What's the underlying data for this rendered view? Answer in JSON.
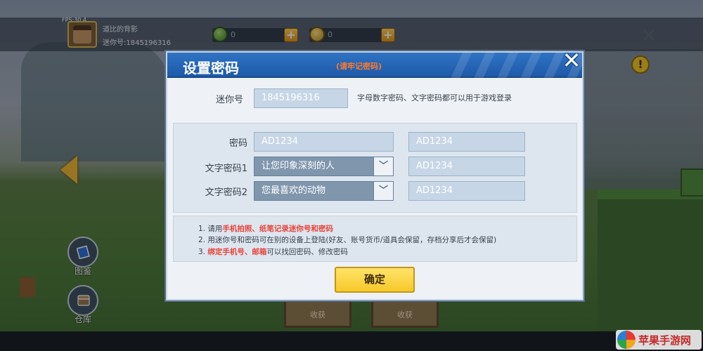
{
  "hud": {
    "fps": "FPS:30.4",
    "username": "道比的背影",
    "mini_id_line": "迷你号:1845196316",
    "currency_green": "0",
    "currency_gold": "0",
    "plus": "+",
    "close_icon": "close-icon",
    "alert": "!"
  },
  "side_buttons": [
    {
      "label": "图鉴",
      "icon": "book-icon"
    },
    {
      "label": "仓库",
      "icon": "chest-icon"
    }
  ],
  "scene": {
    "slot_labels": [
      "收获",
      "收获"
    ]
  },
  "dialog": {
    "title": "设置密码",
    "subtitle": "(请牢记密码)",
    "close": "✕",
    "mini_id_label": "迷你号",
    "mini_id_value": "1845196316",
    "mini_id_hint": "字母数字密码、文字密码都可以用于游戏登录",
    "rows": [
      {
        "label": "密码",
        "value": "AD1234",
        "confirm": "AD1234"
      },
      {
        "label": "文字密码1",
        "value": "让您印象深刻的人",
        "confirm": "AD1234"
      },
      {
        "label": "文字密码2",
        "value": "您最喜欢的动物",
        "confirm": "AD1234"
      }
    ],
    "notes": [
      {
        "prefix": "1. 请用",
        "highlight": "手机拍照、纸笔记录迷你号和密码",
        "suffix": ""
      },
      {
        "prefix": "2. 用迷你号和密码可在别的设备上登陆(好友、账号货币/道具会保留，存档分享后才会保留)",
        "highlight": "",
        "suffix": ""
      },
      {
        "prefix": "3. ",
        "highlight": "绑定手机号、邮箱",
        "suffix": "可以找回密码、修改密码"
      }
    ],
    "confirm_button": "确定"
  },
  "watermark": {
    "text": "苹果手游网"
  },
  "colors": {
    "header_blue": "#1e5aa8",
    "subtitle_orange": "#ff7a2a",
    "highlight_red": "#e8443a",
    "button_yellow": "#f7c928"
  }
}
